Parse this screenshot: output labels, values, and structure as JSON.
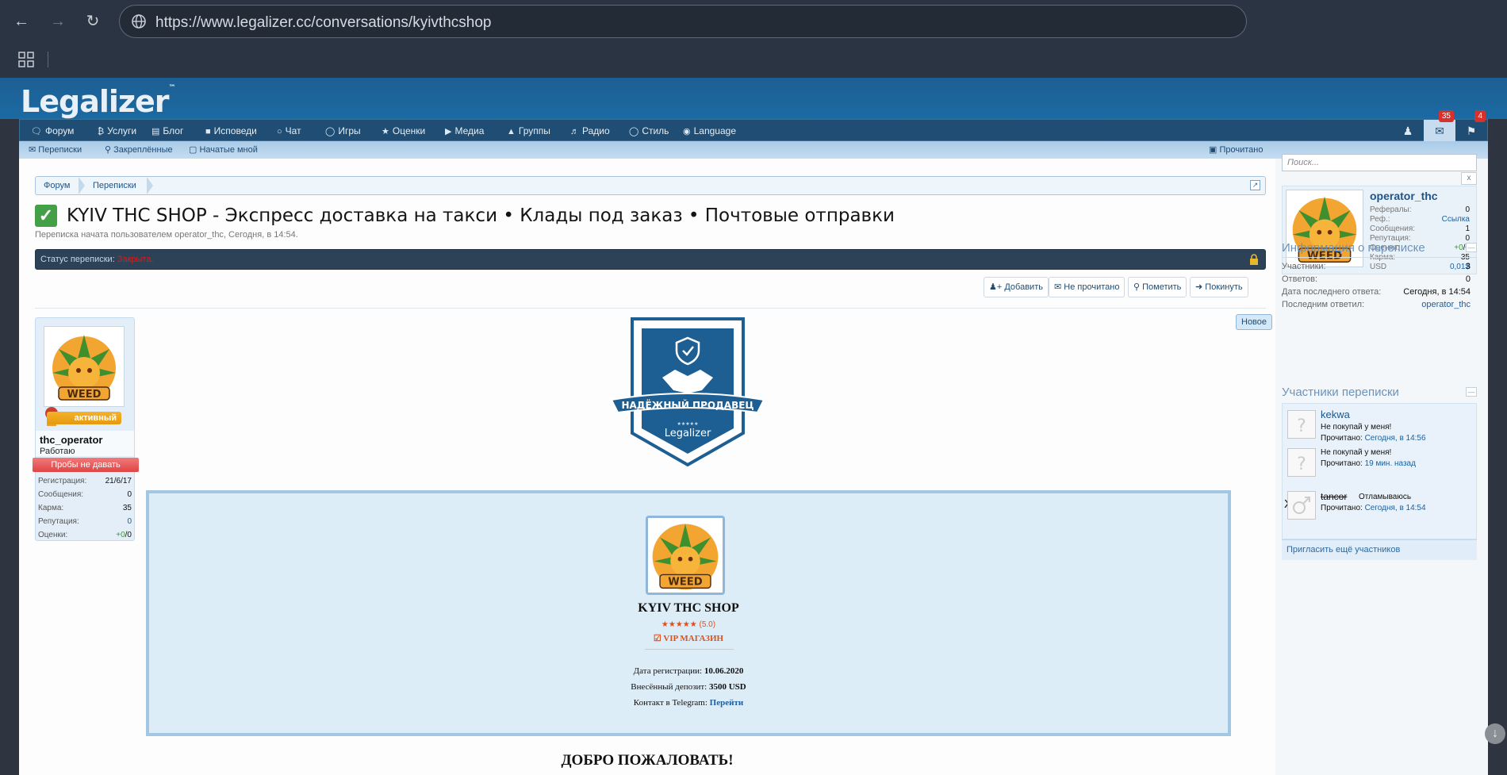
{
  "browser": {
    "url": "https://www.legalizer.cc/conversations/kyivthcshop",
    "back_icon": "arrow-left-icon",
    "forward_icon": "arrow-right-icon",
    "reload_icon": "reload-icon"
  },
  "site": {
    "logo": "Legalizer",
    "logo_tm": "™"
  },
  "nav": {
    "items": [
      {
        "icon": "comments-icon",
        "label": "Форум"
      },
      {
        "icon": "bitcoin-icon",
        "label": "Услуги"
      },
      {
        "icon": "book-icon",
        "label": "Блог"
      },
      {
        "icon": "confession-icon",
        "label": "Исповеди"
      },
      {
        "icon": "chat-icon",
        "label": "Чат"
      },
      {
        "icon": "gamepad-icon",
        "label": "Игры"
      },
      {
        "icon": "trophy-icon",
        "label": "Оценки"
      },
      {
        "icon": "youtube-icon",
        "label": "Медиа"
      },
      {
        "icon": "groups-icon",
        "label": "Группы"
      },
      {
        "icon": "volume-icon",
        "label": "Радио"
      },
      {
        "icon": "bulb-icon",
        "label": "Стиль"
      },
      {
        "icon": "globe-icon",
        "label": "Language"
      }
    ],
    "inbox_badge": "35",
    "alerts_badge": "4"
  },
  "subnav": {
    "items": [
      "Переписки",
      "Закреплённые",
      "Начатые мной"
    ],
    "mark_read": "Прочитано"
  },
  "breadcrumb": [
    "Форум",
    "Переписки"
  ],
  "title": "KYIV THC SHOP - Экспресс доставка на такси • Клады под заказ • Почтовые отправки",
  "subtitle": "Переписка начата пользователем operator_thc, Сегодня, в 14:54.",
  "status": {
    "label": "Статус переписки:",
    "value": "Закрыта."
  },
  "actions": [
    "Добавить",
    "Не прочитано",
    "Пометить",
    "Покинуть"
  ],
  "message": {
    "new_label": "Новое",
    "user": {
      "active_badge": "активный",
      "name": "thc_operator",
      "title": "Работаю",
      "warning": "Пробы не давать",
      "stats": [
        {
          "label": "Регистрация:",
          "value": "21/6/17"
        },
        {
          "label": "Сообщения:",
          "value": "0"
        },
        {
          "label": "Карма:",
          "value": "35"
        },
        {
          "label": "Репутация:",
          "value": "0"
        },
        {
          "label": "Оценки:",
          "value_pos": "+0",
          "value_rest": "/0"
        }
      ]
    },
    "seller_badge_text": "НАДЁЖНЫЙ ПРОДАВЕЦ",
    "seller_badge_brand": "Legalizer",
    "seller_badge_stars": "★★★★★",
    "shop": {
      "avatar_text": "WEED",
      "name": "KYIV THC SHOP",
      "rating": "★★★★★ (5.0)",
      "vip": "☑ VIP МАГАЗИН",
      "reg_label": "Дата регистрации:",
      "reg_value": "10.06.2020",
      "deposit_label": "Внесённый депозит:",
      "deposit_value": "3500 USD",
      "contact_label": "Контакт в Telegram:",
      "contact_link": "Перейти"
    },
    "welcome": "ДОБРО ПОЖАЛОВАТЬ!"
  },
  "sidebar": {
    "search_placeholder": "Поиск...",
    "close_label": "x",
    "visitor": {
      "name": "operator_thc",
      "stats": [
        {
          "label": "Рефералы:",
          "value": "0"
        },
        {
          "label": "Реф.:",
          "value": "Ссылка"
        },
        {
          "label": "Сообщения:",
          "value": "1"
        },
        {
          "label": "Репутация:",
          "value": "0"
        },
        {
          "label": "Оценки:",
          "value_pos": "+0",
          "value_rest": "/0"
        },
        {
          "label": "Карма:",
          "value": "35"
        },
        {
          "label": "USD",
          "value": "0,01$"
        }
      ]
    },
    "info_title": "Информация о переписке",
    "info": [
      {
        "label": "Участники:",
        "value": "3"
      },
      {
        "label": "Ответов:",
        "value": "0"
      },
      {
        "label": "Дата последнего ответа:",
        "value": "Сегодня, в 14:54"
      },
      {
        "label": "Последним ответил:",
        "value": "operator_thc"
      }
    ],
    "participants_title": "Участники переписки",
    "participants": [
      {
        "name": "kekwa",
        "msg": "Не покупай у меня!",
        "read_label": "Прочитано:",
        "read_value": "Сегодня, в 14:56"
      },
      {
        "name": "",
        "msg": "Не покупай у меня!",
        "read_label": "Прочитано:",
        "read_value": "19 мин. назад"
      },
      {
        "name": "tancor",
        "msg": "Отламываюсь",
        "read_label": "Прочитано:",
        "read_value": "Сегодня, в 14:54",
        "mark": "X"
      }
    ],
    "invite": "Пригласить ещё участников"
  }
}
